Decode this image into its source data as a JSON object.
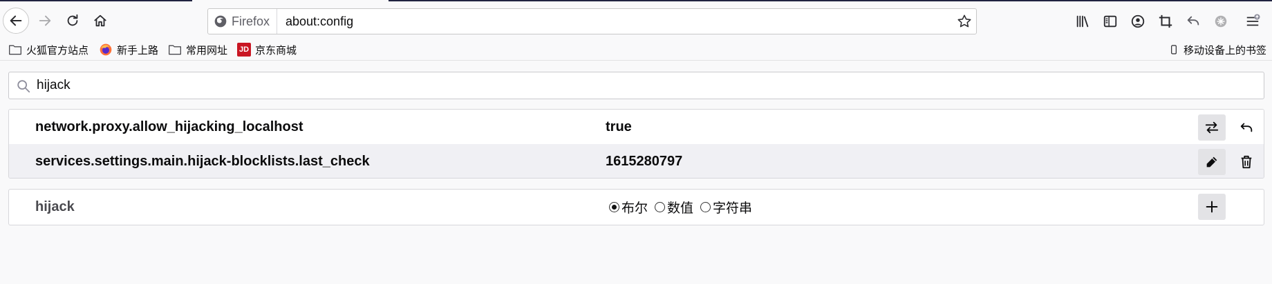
{
  "toolbar": {
    "identity_label": "Firefox",
    "url": "about:config"
  },
  "bookmarks": [
    {
      "label": "火狐官方站点",
      "icon": "folder-icon"
    },
    {
      "label": "新手上路",
      "icon": "firefox-icon"
    },
    {
      "label": "常用网址",
      "icon": "folder-icon"
    },
    {
      "label": "京东商城",
      "icon": "jd-icon",
      "icon_text": "JD"
    }
  ],
  "mobile_bookmarks": "移动设备上的书签",
  "search": {
    "value": "hijack"
  },
  "prefs": [
    {
      "name": "network.proxy.allow_hijacking_localhost",
      "value": "true",
      "actions": [
        "toggle-icon",
        "reset-icon"
      ]
    },
    {
      "name": "services.settings.main.hijack-blocklists.last_check",
      "value": "1615280797",
      "actions": [
        "edit-icon",
        "delete-icon"
      ]
    }
  ],
  "new_pref": {
    "name": "hijack",
    "types": [
      "布尔",
      "数值",
      "字符串"
    ],
    "selected": "布尔"
  },
  "colors": {
    "accent": "#0a84ff",
    "jd_red": "#c91623",
    "row_alt": "#f0f0f4"
  }
}
